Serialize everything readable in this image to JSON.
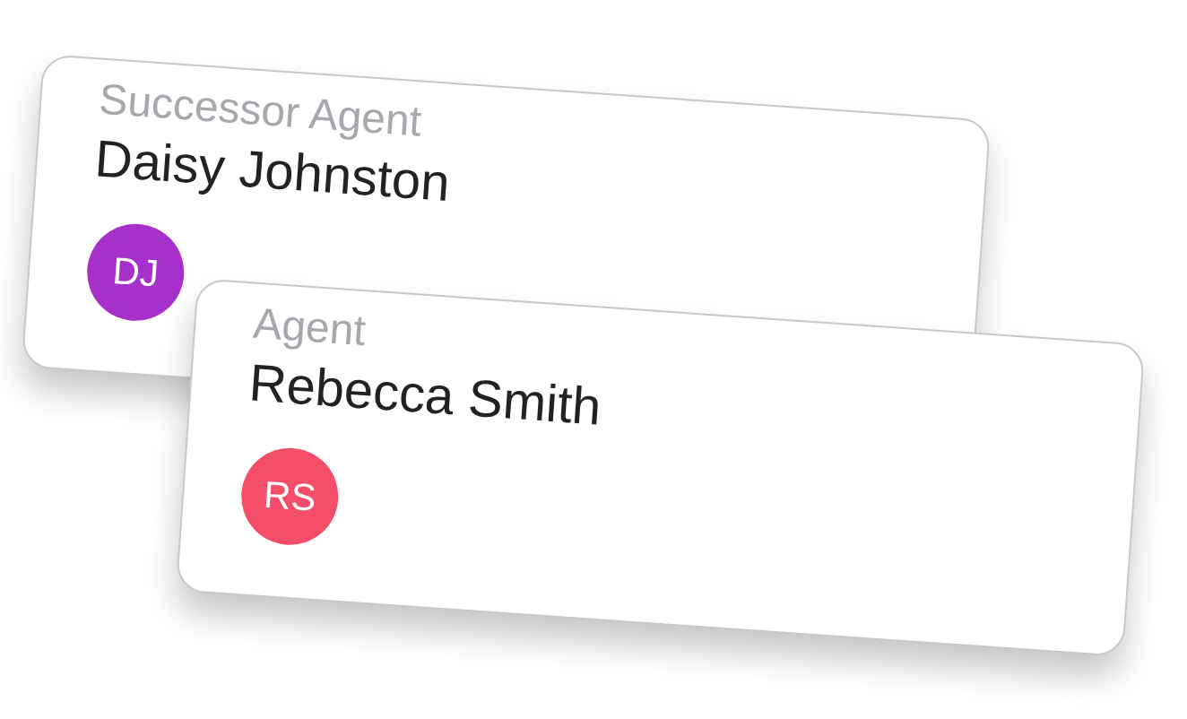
{
  "cards": [
    {
      "label": "Successor Agent",
      "name": "Daisy Johnston",
      "initials": "DJ",
      "color": "#a72fca"
    },
    {
      "label": "Agent",
      "name": "Rebecca Smith",
      "initials": "RS",
      "color": "#f44d68"
    }
  ]
}
